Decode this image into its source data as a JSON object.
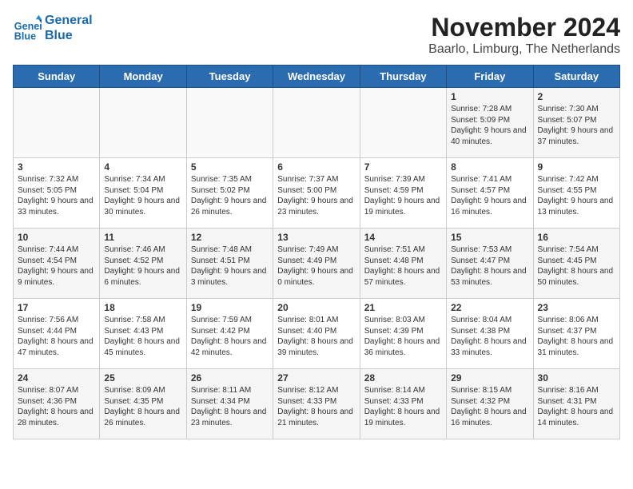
{
  "header": {
    "logo_line1": "General",
    "logo_line2": "Blue",
    "month": "November 2024",
    "location": "Baarlo, Limburg, The Netherlands"
  },
  "weekdays": [
    "Sunday",
    "Monday",
    "Tuesday",
    "Wednesday",
    "Thursday",
    "Friday",
    "Saturday"
  ],
  "rows": [
    [
      {
        "day": "",
        "info": ""
      },
      {
        "day": "",
        "info": ""
      },
      {
        "day": "",
        "info": ""
      },
      {
        "day": "",
        "info": ""
      },
      {
        "day": "",
        "info": ""
      },
      {
        "day": "1",
        "info": "Sunrise: 7:28 AM\nSunset: 5:09 PM\nDaylight: 9 hours and 40 minutes."
      },
      {
        "day": "2",
        "info": "Sunrise: 7:30 AM\nSunset: 5:07 PM\nDaylight: 9 hours and 37 minutes."
      }
    ],
    [
      {
        "day": "3",
        "info": "Sunrise: 7:32 AM\nSunset: 5:05 PM\nDaylight: 9 hours and 33 minutes."
      },
      {
        "day": "4",
        "info": "Sunrise: 7:34 AM\nSunset: 5:04 PM\nDaylight: 9 hours and 30 minutes."
      },
      {
        "day": "5",
        "info": "Sunrise: 7:35 AM\nSunset: 5:02 PM\nDaylight: 9 hours and 26 minutes."
      },
      {
        "day": "6",
        "info": "Sunrise: 7:37 AM\nSunset: 5:00 PM\nDaylight: 9 hours and 23 minutes."
      },
      {
        "day": "7",
        "info": "Sunrise: 7:39 AM\nSunset: 4:59 PM\nDaylight: 9 hours and 19 minutes."
      },
      {
        "day": "8",
        "info": "Sunrise: 7:41 AM\nSunset: 4:57 PM\nDaylight: 9 hours and 16 minutes."
      },
      {
        "day": "9",
        "info": "Sunrise: 7:42 AM\nSunset: 4:55 PM\nDaylight: 9 hours and 13 minutes."
      }
    ],
    [
      {
        "day": "10",
        "info": "Sunrise: 7:44 AM\nSunset: 4:54 PM\nDaylight: 9 hours and 9 minutes."
      },
      {
        "day": "11",
        "info": "Sunrise: 7:46 AM\nSunset: 4:52 PM\nDaylight: 9 hours and 6 minutes."
      },
      {
        "day": "12",
        "info": "Sunrise: 7:48 AM\nSunset: 4:51 PM\nDaylight: 9 hours and 3 minutes."
      },
      {
        "day": "13",
        "info": "Sunrise: 7:49 AM\nSunset: 4:49 PM\nDaylight: 9 hours and 0 minutes."
      },
      {
        "day": "14",
        "info": "Sunrise: 7:51 AM\nSunset: 4:48 PM\nDaylight: 8 hours and 57 minutes."
      },
      {
        "day": "15",
        "info": "Sunrise: 7:53 AM\nSunset: 4:47 PM\nDaylight: 8 hours and 53 minutes."
      },
      {
        "day": "16",
        "info": "Sunrise: 7:54 AM\nSunset: 4:45 PM\nDaylight: 8 hours and 50 minutes."
      }
    ],
    [
      {
        "day": "17",
        "info": "Sunrise: 7:56 AM\nSunset: 4:44 PM\nDaylight: 8 hours and 47 minutes."
      },
      {
        "day": "18",
        "info": "Sunrise: 7:58 AM\nSunset: 4:43 PM\nDaylight: 8 hours and 45 minutes."
      },
      {
        "day": "19",
        "info": "Sunrise: 7:59 AM\nSunset: 4:42 PM\nDaylight: 8 hours and 42 minutes."
      },
      {
        "day": "20",
        "info": "Sunrise: 8:01 AM\nSunset: 4:40 PM\nDaylight: 8 hours and 39 minutes."
      },
      {
        "day": "21",
        "info": "Sunrise: 8:03 AM\nSunset: 4:39 PM\nDaylight: 8 hours and 36 minutes."
      },
      {
        "day": "22",
        "info": "Sunrise: 8:04 AM\nSunset: 4:38 PM\nDaylight: 8 hours and 33 minutes."
      },
      {
        "day": "23",
        "info": "Sunrise: 8:06 AM\nSunset: 4:37 PM\nDaylight: 8 hours and 31 minutes."
      }
    ],
    [
      {
        "day": "24",
        "info": "Sunrise: 8:07 AM\nSunset: 4:36 PM\nDaylight: 8 hours and 28 minutes."
      },
      {
        "day": "25",
        "info": "Sunrise: 8:09 AM\nSunset: 4:35 PM\nDaylight: 8 hours and 26 minutes."
      },
      {
        "day": "26",
        "info": "Sunrise: 8:11 AM\nSunset: 4:34 PM\nDaylight: 8 hours and 23 minutes."
      },
      {
        "day": "27",
        "info": "Sunrise: 8:12 AM\nSunset: 4:33 PM\nDaylight: 8 hours and 21 minutes."
      },
      {
        "day": "28",
        "info": "Sunrise: 8:14 AM\nSunset: 4:33 PM\nDaylight: 8 hours and 19 minutes."
      },
      {
        "day": "29",
        "info": "Sunrise: 8:15 AM\nSunset: 4:32 PM\nDaylight: 8 hours and 16 minutes."
      },
      {
        "day": "30",
        "info": "Sunrise: 8:16 AM\nSunset: 4:31 PM\nDaylight: 8 hours and 14 minutes."
      }
    ]
  ]
}
